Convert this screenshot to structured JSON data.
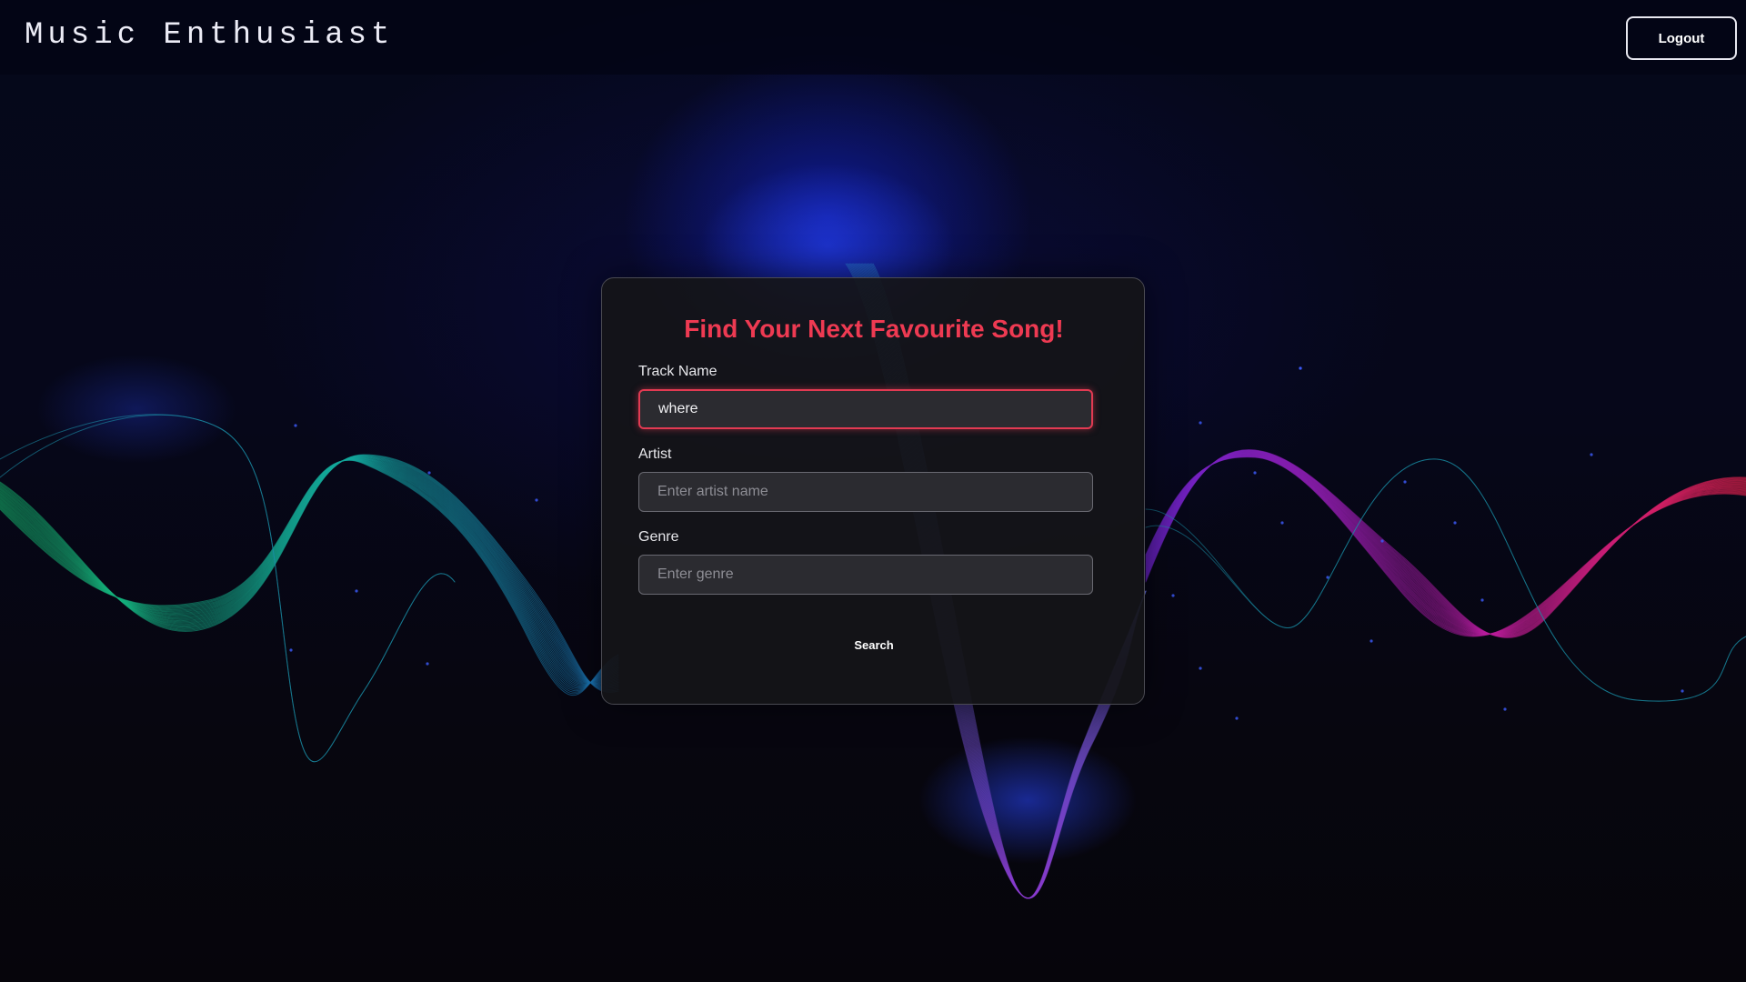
{
  "header": {
    "brand": "Music Enthusiast",
    "logout_label": "Logout"
  },
  "search_form": {
    "title": "Find Your Next Favourite Song!",
    "track": {
      "label": "Track Name",
      "value": "where",
      "placeholder": ""
    },
    "artist": {
      "label": "Artist",
      "value": "",
      "placeholder": "Enter artist name"
    },
    "genre": {
      "label": "Genre",
      "value": "",
      "placeholder": "Enter genre"
    },
    "search_label": "Search"
  },
  "colors": {
    "accent": "#ee3a52",
    "background": "#07060d",
    "card": "#141418",
    "input": "#2b2b30"
  }
}
